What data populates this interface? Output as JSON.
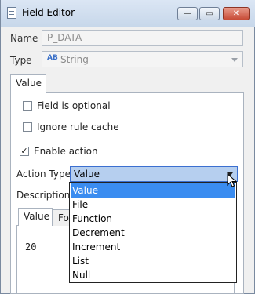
{
  "window": {
    "title": "Field Editor"
  },
  "form": {
    "name_label": "Name",
    "name_value": "P_DATA",
    "type_label": "Type",
    "type_icon_text": "AB",
    "type_value": "String"
  },
  "tabs": {
    "outer_value": "Value",
    "inner_value": "Value",
    "inner_second": "For"
  },
  "checks": {
    "field_optional": "Field is optional",
    "ignore_cache": "Ignore rule cache",
    "enable_action": "Enable action",
    "enable_action_checked": true
  },
  "action": {
    "label": "Action Type",
    "selected": "Value"
  },
  "description_label": "Description",
  "value_text": "20",
  "dropdown": {
    "options": [
      "Value",
      "File",
      "Function",
      "Decrement",
      "Increment",
      "List",
      "Null"
    ],
    "selected_index": 0
  }
}
